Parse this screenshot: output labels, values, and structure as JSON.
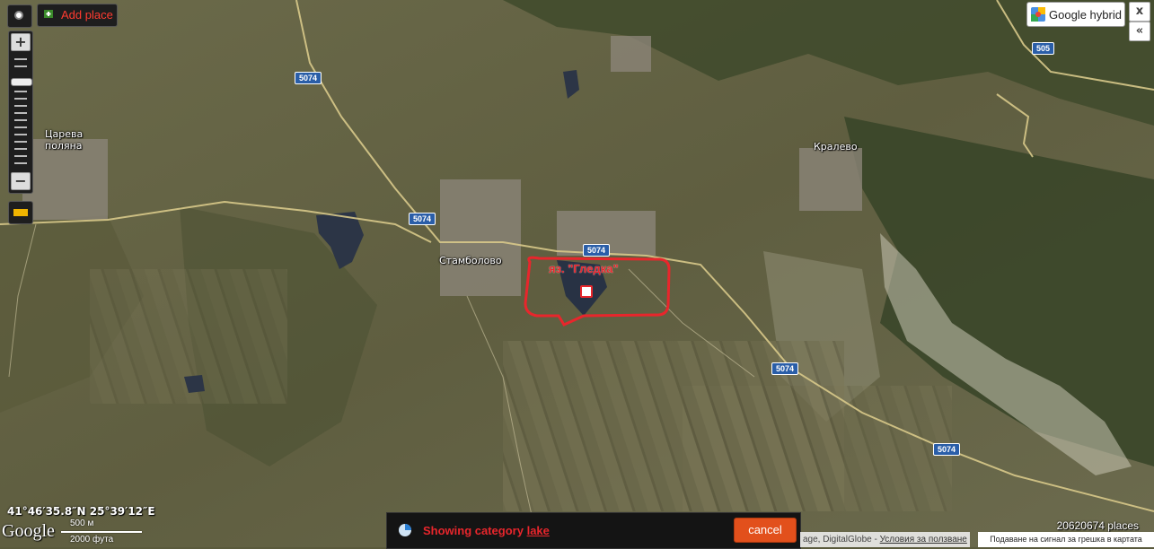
{
  "toolbar": {
    "add_place_label": "Add place",
    "locate_icon": "target-icon",
    "add_place_icon": "add-place-icon",
    "ruler_icon": "ruler-icon"
  },
  "zoom": {
    "zoom_in_label": "+",
    "zoom_out_label": "−",
    "level_fraction": 0.22
  },
  "map_type": {
    "label": "Google hybrid",
    "icon": "google-maps-icon"
  },
  "corner_buttons": {
    "close_label": "x",
    "collapse_label": "«"
  },
  "map": {
    "towns": [
      {
        "name": "Царева\nполяна"
      },
      {
        "name": "Стамболово"
      },
      {
        "name": "Кралево"
      }
    ],
    "road_labels": [
      "5074",
      "5074",
      "5074",
      "5074",
      "5074",
      "505"
    ],
    "annotation": {
      "text": "яз. \"Гледка\"",
      "color": "#e8262c"
    }
  },
  "status": {
    "coordinates": "41°46′35.8″N 25°39′12″E",
    "google_logo": "Google",
    "scale_metric": "500 м",
    "scale_imperial": "2000 фута",
    "places_count": "20620674 places"
  },
  "category_bar": {
    "prefix": "Showing category ",
    "category": "lake",
    "cancel_label": "cancel",
    "icon": "loading-icon"
  },
  "attribution": {
    "text": "age, DigitalGlobe - ",
    "terms": "Условия за ползване",
    "report": "Подаване на сигнал за грешка в картата"
  },
  "colors": {
    "accent_red": "#e8262c",
    "cancel_orange": "#e2501c",
    "road_blue": "#2a5ea8"
  }
}
